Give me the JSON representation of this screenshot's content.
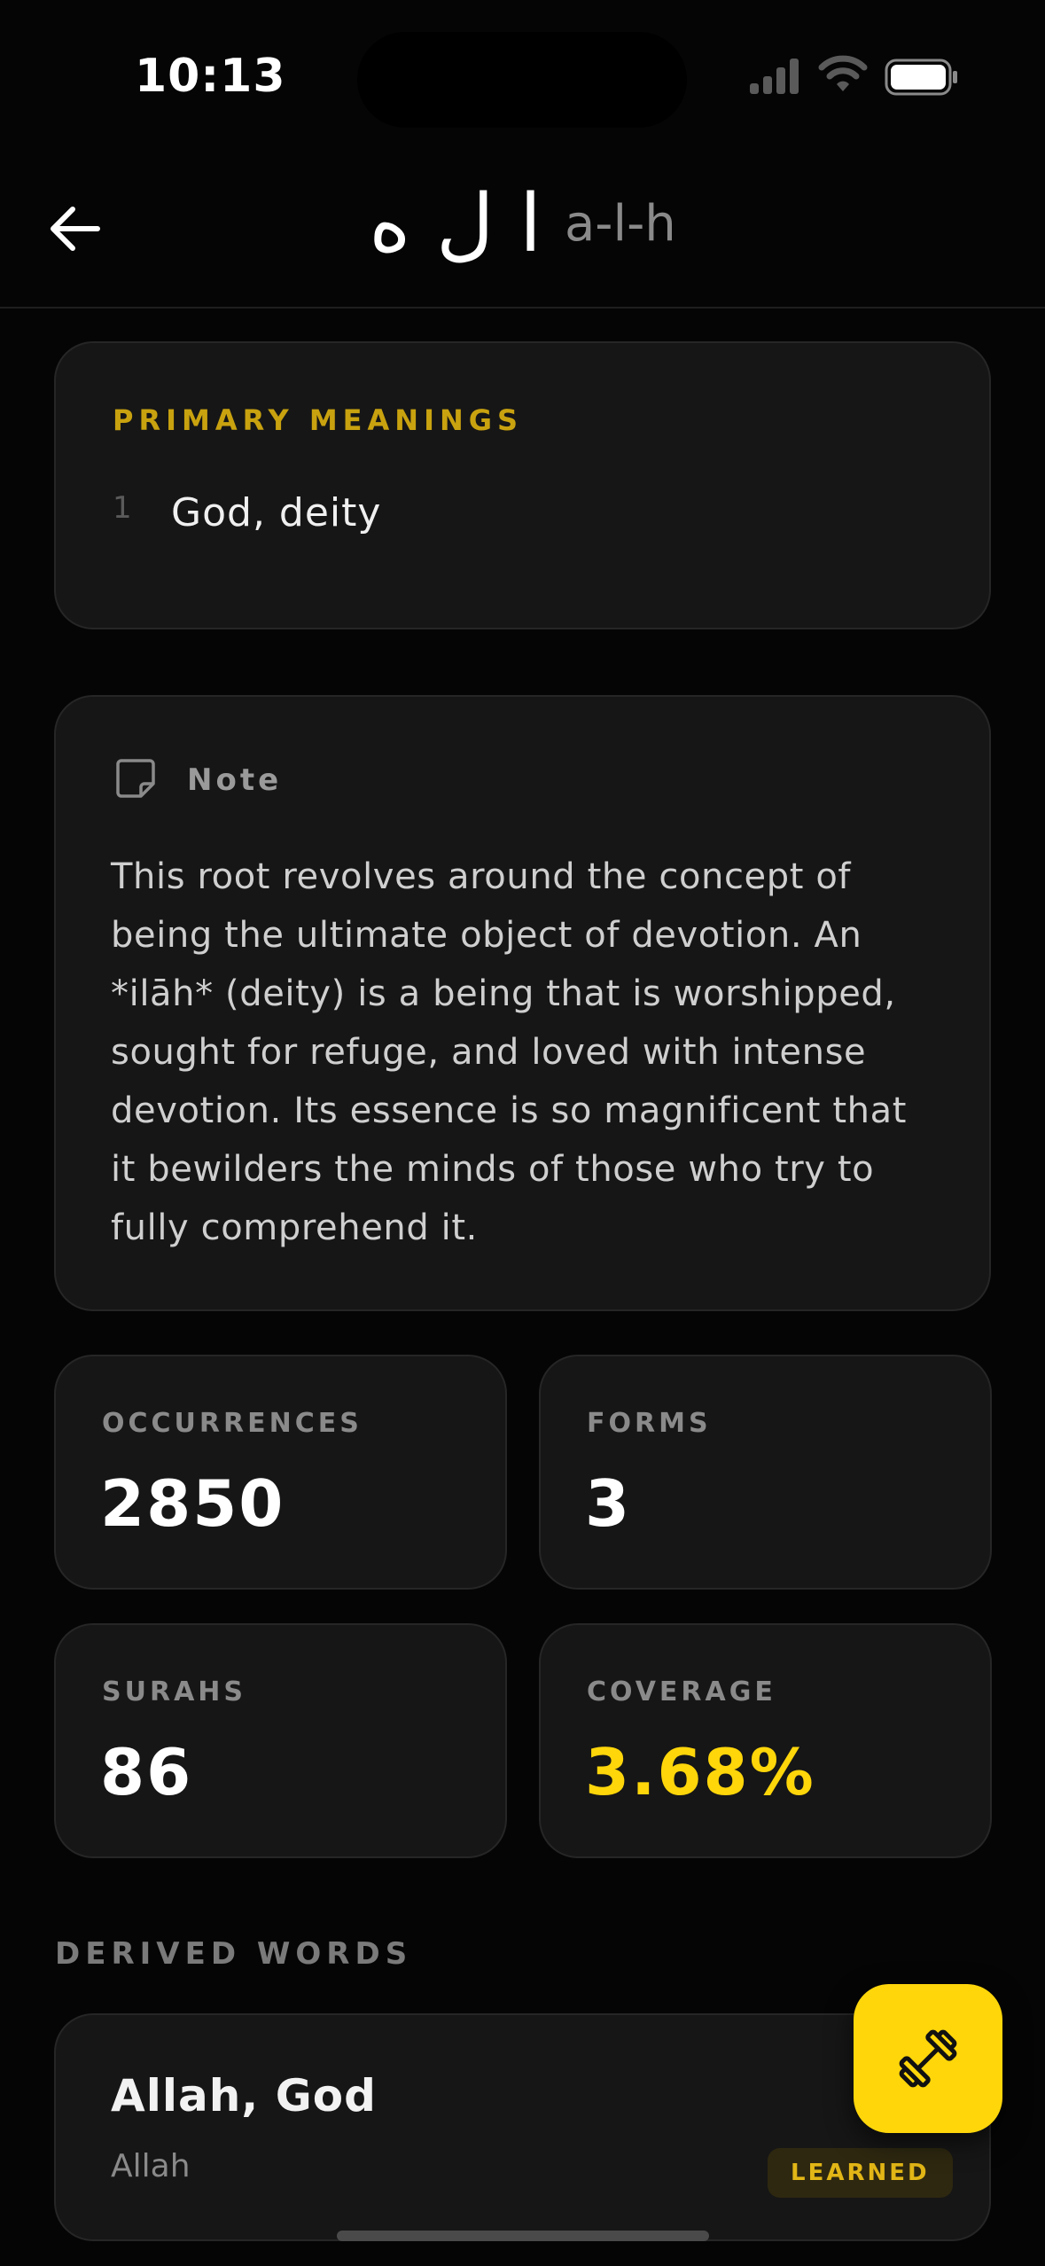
{
  "status_bar": {
    "time": "10:13"
  },
  "header": {
    "root_arabic": "ا ل ه",
    "root_transliteration": "a-l-h"
  },
  "meanings": {
    "label": "PRIMARY MEANINGS",
    "items": [
      {
        "number": "1",
        "text": "God, deity"
      }
    ]
  },
  "note": {
    "title": "Note",
    "text": "This root revolves around the concept of being the ultimate object of devotion. An *ilāh* (deity) is a being that is worshipped, sought for refuge, and loved with intense devotion. Its essence is so magnificent that it bewilders the minds of those who try to fully comprehend it."
  },
  "stats": [
    {
      "label": "OCCURRENCES",
      "value": "2850"
    },
    {
      "label": "FORMS",
      "value": "3"
    },
    {
      "label": "SURAHS",
      "value": "86"
    },
    {
      "label": "COVERAGE",
      "value": "3.68%"
    }
  ],
  "derived": {
    "label": "DERIVED WORDS",
    "words": [
      {
        "title": "Allah, God",
        "transliteration": "Allah",
        "badge": "LEARNED"
      }
    ]
  },
  "colors": {
    "accent": "#ffd60a",
    "label_gold": "#c9a20f",
    "background": "#050505",
    "card": "#161616"
  },
  "icons": {
    "back": "arrow-left-icon",
    "note": "sticky-note-icon",
    "fab": "dumbbell-icon"
  }
}
